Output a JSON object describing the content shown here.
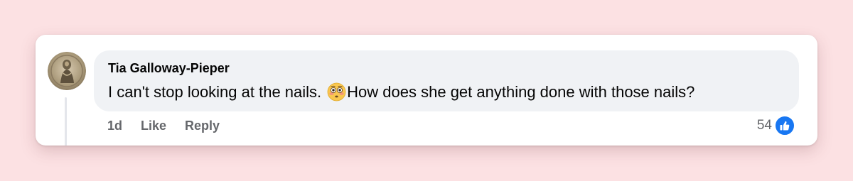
{
  "comment": {
    "author": "Tia Galloway-Pieper",
    "text_before": "I can't stop looking at the nails.",
    "emoji_icon": "flushed-face-icon",
    "text_after": "How does she get anything done with those nails?",
    "timestamp": "1d",
    "like_label": "Like",
    "reply_label": "Reply",
    "reaction_count": "54",
    "reaction_icon": "like-thumb-icon"
  },
  "colors": {
    "background": "#fce1e3",
    "bubble": "#f0f2f5",
    "muted_text": "#65676b",
    "like_blue": "#1877f2"
  }
}
